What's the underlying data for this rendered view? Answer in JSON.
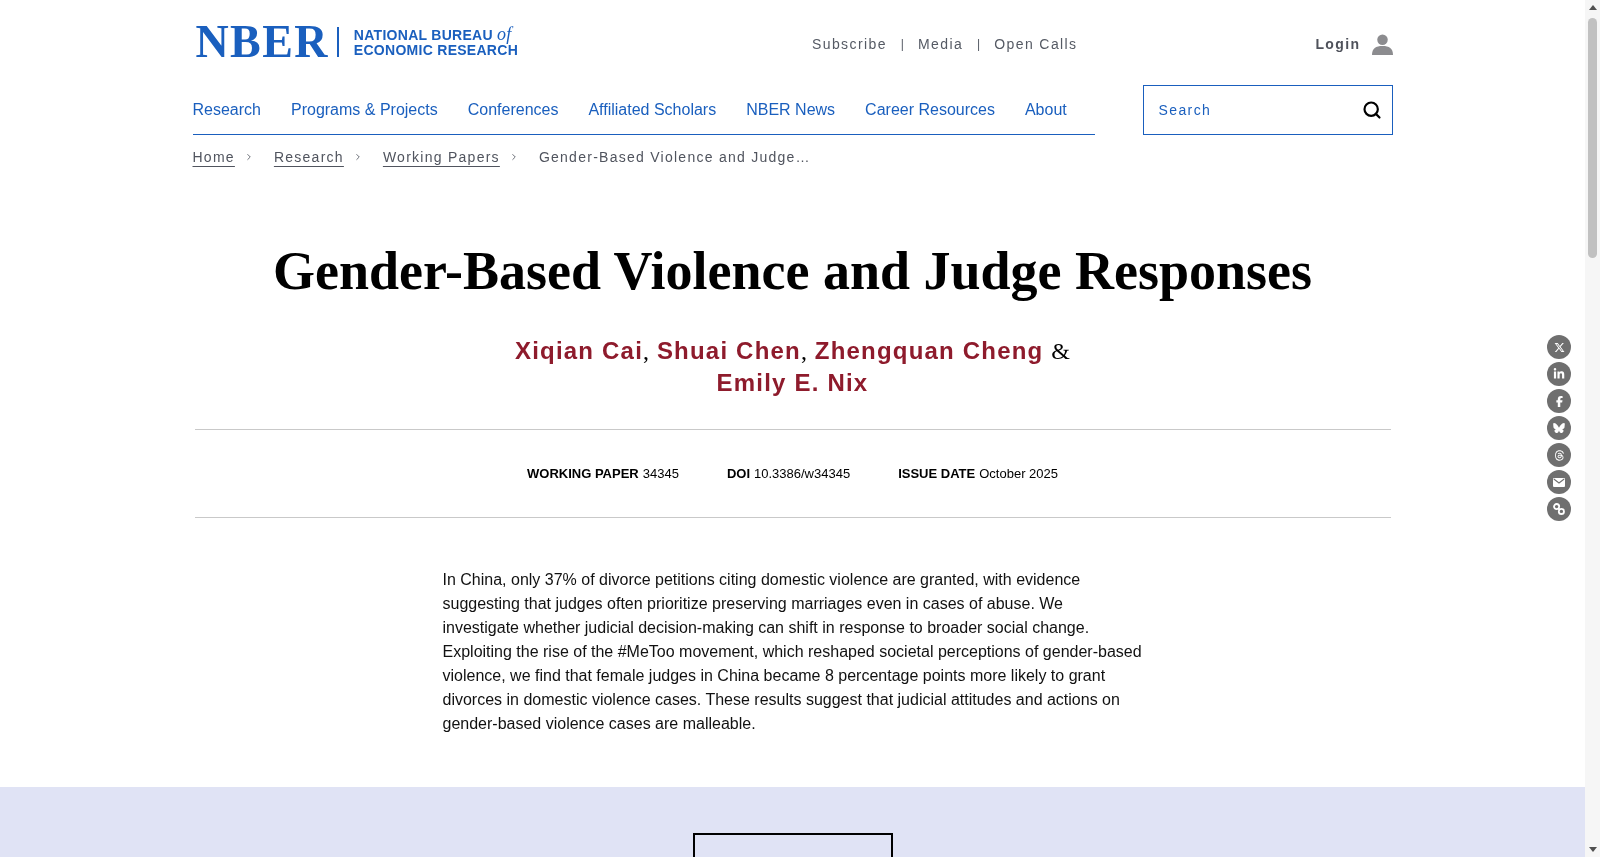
{
  "header": {
    "logo": {
      "wordmark": "NBER",
      "lines": [
        "NATIONAL BUREAU *of*",
        "ECONOMIC RESEARCH"
      ]
    },
    "utility_nav": [
      {
        "kind": "link",
        "text": "Subscribe"
      },
      {
        "kind": "separator",
        "text": "|"
      },
      {
        "kind": "link",
        "text": "Media"
      },
      {
        "kind": "separator",
        "text": "|"
      },
      {
        "kind": "link",
        "text": "Open Calls"
      }
    ],
    "login": {
      "label": "Login"
    }
  },
  "main_nav": {
    "items": [
      "Research",
      "Programs & Projects",
      "Conferences",
      "Affiliated Scholars",
      "NBER News",
      "Career Resources",
      "About"
    ]
  },
  "search": {
    "placeholder": "Search"
  },
  "breadcrumb": [
    {
      "kind": "link",
      "text": "Home"
    },
    {
      "kind": "link",
      "text": "Research"
    },
    {
      "kind": "link",
      "text": "Working Papers"
    },
    {
      "kind": "current",
      "text": "Gender-Based Violence and Judge…"
    }
  ],
  "paper": {
    "title": "Gender-Based Violence and Judge Responses",
    "byline": [
      {
        "kind": "author",
        "text": "Xiqian Cai"
      },
      {
        "kind": "punctuation",
        "text": ","
      },
      {
        "kind": "author",
        "text": "Shuai Chen"
      },
      {
        "kind": "punctuation",
        "text": ","
      },
      {
        "kind": "author",
        "text": "Zhengquan Cheng"
      },
      {
        "kind": "conjunction",
        "text": "&"
      },
      {
        "kind": "author",
        "text": "Emily E. Nix"
      }
    ],
    "metadata": [
      {
        "label": "WORKING PAPER",
        "value": "34345"
      },
      {
        "label": "DOI",
        "value": "10.3386/w34345"
      },
      {
        "label": "ISSUE DATE",
        "value": "October 2025"
      }
    ],
    "abstract": "In China, only 37% of divorce petitions citing domestic violence are granted, with evidence suggesting that judges often prioritize preserving marriages even in cases of abuse. We investigate whether judicial decision-making can shift in response to broader social change. Exploiting the rise of the #MeToo movement, which reshaped societal perceptions of gender-based violence, we find that female judges in China became 8 percentage points more likely to grant divorces in domestic violence cases. These results suggest that judicial attitudes and actions on gender-based violence cases are malleable."
  }
}
